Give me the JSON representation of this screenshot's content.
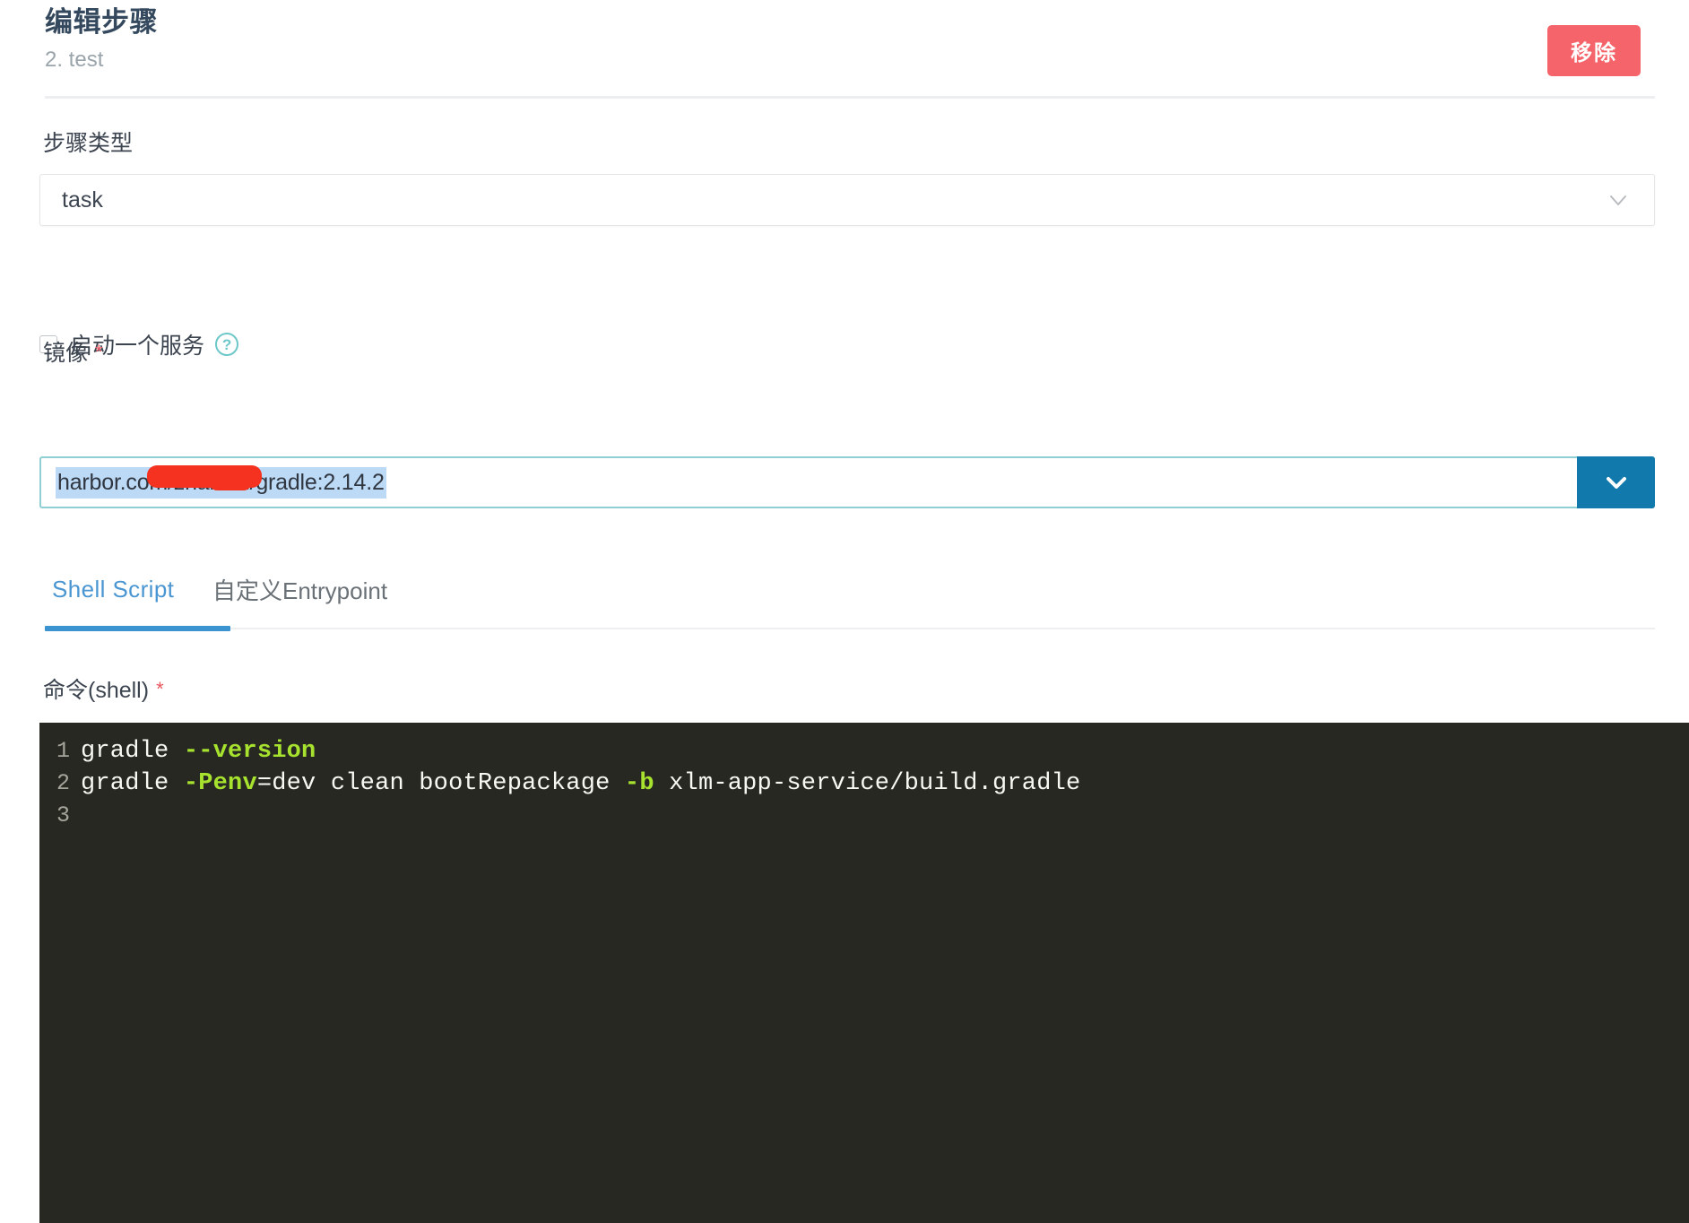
{
  "header": {
    "title": "编辑步骤",
    "subtitle": "2. test",
    "remove_label": "移除"
  },
  "form": {
    "step_type": {
      "label": "步骤类型",
      "value": "task",
      "chevron_icon": "chevron-down-icon"
    },
    "service_checkbox": {
      "label": "启动一个服务",
      "checked": false,
      "help_icon_char": "?"
    },
    "image": {
      "label": "镜像",
      "required_mark": "*",
      "value": "harbor.com/zhaikun/gradle:2.14.2",
      "value_prefix": "harbor.",
      "value_suffix": ".com/zhaikun/gradle:2.14.2",
      "redacted": true,
      "dropdown_icon": "chevron-down-icon"
    },
    "command": {
      "label": "命令(shell)",
      "required_mark": "*"
    }
  },
  "tabs": [
    {
      "label": "Shell Script",
      "active": true
    },
    {
      "label": "自定义Entrypoint",
      "active": false
    }
  ],
  "editor": {
    "language": "shell",
    "theme_bg": "#272822",
    "lines": [
      {
        "number": "1",
        "segments": [
          {
            "text": "gradle ",
            "type": "plain"
          },
          {
            "text": "--version",
            "type": "flag"
          }
        ]
      },
      {
        "number": "2",
        "segments": [
          {
            "text": "gradle ",
            "type": "plain"
          },
          {
            "text": "-Penv",
            "type": "flag"
          },
          {
            "text": "=dev clean bootRepackage ",
            "type": "plain"
          },
          {
            "text": "-b",
            "type": "flag"
          },
          {
            "text": " xlm-app-service/build.gradle",
            "type": "plain"
          }
        ]
      },
      {
        "number": "3",
        "segments": []
      }
    ],
    "line_1_number": "1",
    "line_1_a": "gradle ",
    "line_1_b": "--version",
    "line_2_number": "2",
    "line_2_a": "gradle ",
    "line_2_b": "-Penv",
    "line_2_c": "=dev clean bootRepackage ",
    "line_2_d": "-b",
    "line_2_e": " xlm-app-service/build.gradle",
    "line_3_number": "3"
  },
  "colors": {
    "accent_blue": "#3b93d0",
    "danger_red": "#f5646a",
    "dropdown_blue": "#1179ab",
    "help_teal": "#6ec7c9",
    "selection_blue": "#bcd9f6",
    "redaction_red": "#f4321f",
    "editor_green": "#a6e22e"
  }
}
